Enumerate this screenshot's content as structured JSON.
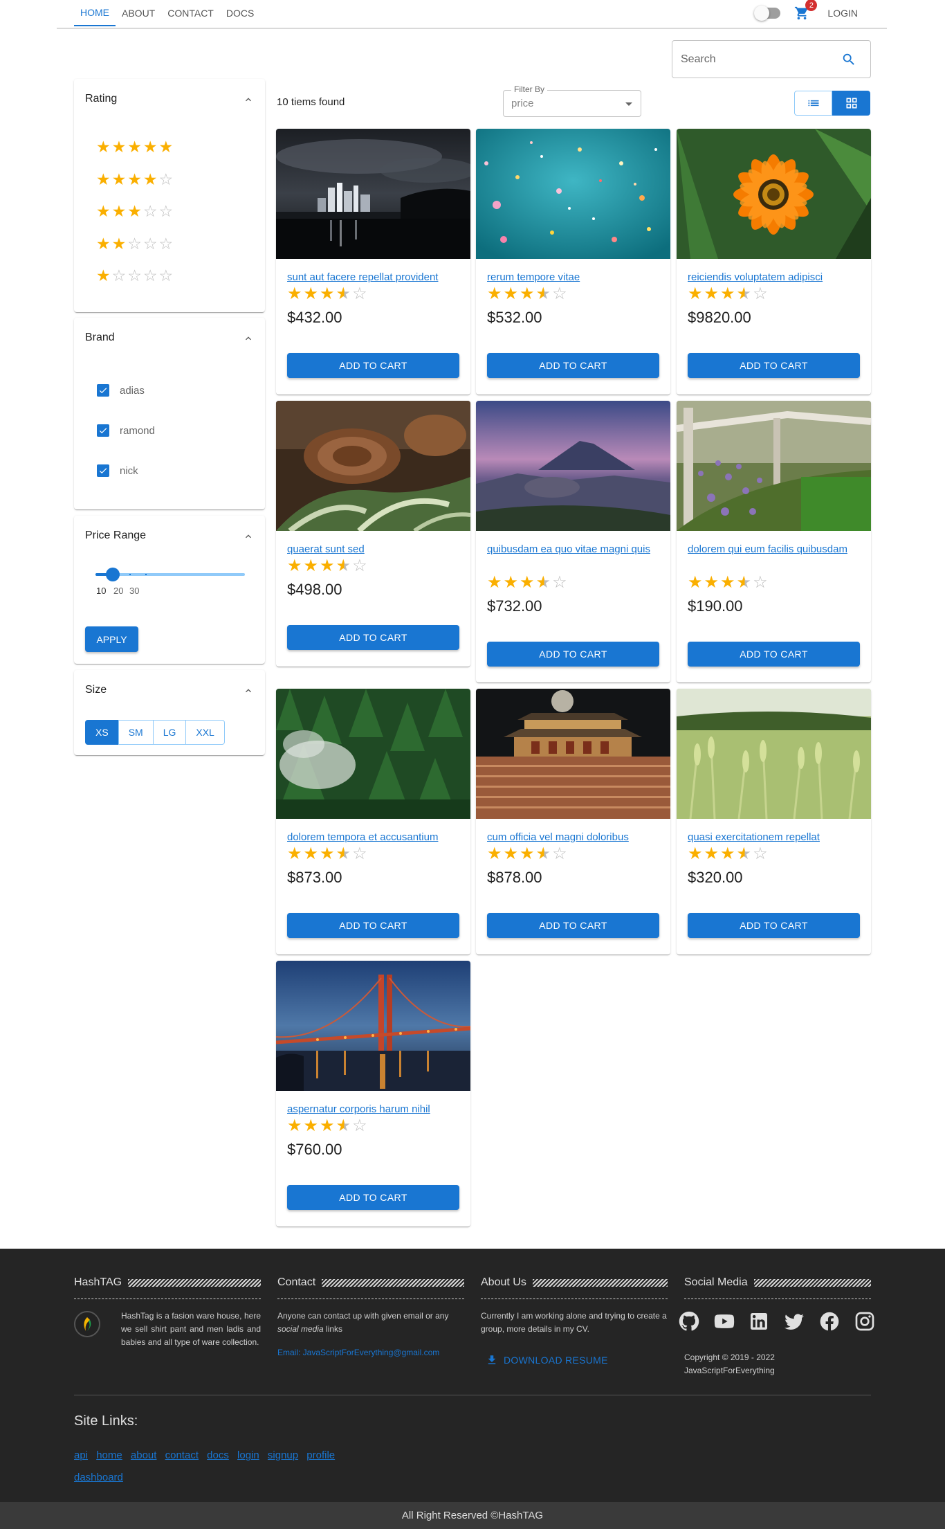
{
  "nav": {
    "items": [
      "Home",
      "About",
      "Contact",
      "Docs"
    ],
    "active": "Home",
    "cart_count": "2",
    "login_label": "Login"
  },
  "search": {
    "placeholder": "Search"
  },
  "filters": {
    "rating": {
      "title": "Rating",
      "options": [
        5,
        4,
        3,
        2,
        1
      ]
    },
    "brand": {
      "title": "Brand",
      "options": [
        {
          "label": "adias",
          "checked": true
        },
        {
          "label": "ramond",
          "checked": true
        },
        {
          "label": "nick",
          "checked": true
        }
      ]
    },
    "price_range": {
      "title": "Price Range",
      "marks": [
        "10",
        "20",
        "30"
      ],
      "value": 10,
      "apply_label": "Apply"
    },
    "size": {
      "title": "Size",
      "options": [
        "XS",
        "SM",
        "LG",
        "XXL"
      ],
      "selected": "XS"
    }
  },
  "results": {
    "count_text": "10 tiems found",
    "filter_label": "Filter By",
    "filter_value": "price",
    "view_mode": "grid"
  },
  "products": [
    {
      "title": "sunt aut facere repellat provident",
      "rating": 3.5,
      "price": "$432.00",
      "image": "city-night-skyline"
    },
    {
      "title": "rerum tempore vitae",
      "rating": 3.5,
      "price": "$532.00",
      "image": "teal-confetti"
    },
    {
      "title": "reiciendis voluptatem adipisci",
      "rating": 3.5,
      "price": "$9820.00",
      "image": "orange-flower"
    },
    {
      "title": "quaerat sunt sed",
      "rating": 3.5,
      "price": "$498.00",
      "image": "forest-ferns"
    },
    {
      "title": "quibusdam ea quo vitae magni quis",
      "rating": 3.5,
      "price": "$732.00",
      "image": "volcano-dusk"
    },
    {
      "title": "dolorem qui eum facilis quibusdam",
      "rating": 3.5,
      "price": "$190.00",
      "image": "lavender-fence"
    },
    {
      "title": "dolorem tempora et accusantium",
      "rating": 3.5,
      "price": "$873.00",
      "image": "misty-pine-forest"
    },
    {
      "title": "cum officia vel magni doloribus",
      "rating": 3.5,
      "price": "$878.00",
      "image": "palace-moon"
    },
    {
      "title": "quasi exercitationem repellat",
      "rating": 3.5,
      "price": "$320.00",
      "image": "wheat-field"
    },
    {
      "title": "aspernatur corporis harum nihil",
      "rating": 3.5,
      "price": "$760.00",
      "image": "golden-gate-bridge"
    }
  ],
  "add_to_cart_label": "Add to cart",
  "footer": {
    "hashtag": {
      "title": "HashTAG",
      "text": "HashTag is a fasion ware house, here we sell shirt pant and men ladis and babies and all type of ware collection."
    },
    "contact": {
      "title": "Contact",
      "text_before": "Anyone can contact up with given email or any",
      "text_em": "social media",
      "text_after": "links",
      "email": "Email: JavaScriptForEverything@gmail.com"
    },
    "about": {
      "title": "About Us",
      "text": "Currently I am working alone and trying to create a group, more details in my CV.",
      "download_label": "Download Resume"
    },
    "social": {
      "title": "Social Media",
      "icons": [
        "github-icon",
        "youtube-icon",
        "linkedin-icon",
        "twitter-icon",
        "facebook-icon",
        "instagram-icon"
      ],
      "copyright": "Copyright © 2019 - 2022",
      "author": "JavaScriptForEverything"
    },
    "site_links_title": "Site Links:",
    "site_links": [
      "api",
      "home",
      "about",
      "contact",
      "docs",
      "login",
      "signup",
      "profile",
      "dashboard"
    ],
    "rights": "All Right Reserved ©HashTAG"
  },
  "colors": {
    "primary": "#1976d2",
    "star": "#faaf00",
    "footer_bg": "#252525",
    "badge": "#d32f2f"
  }
}
